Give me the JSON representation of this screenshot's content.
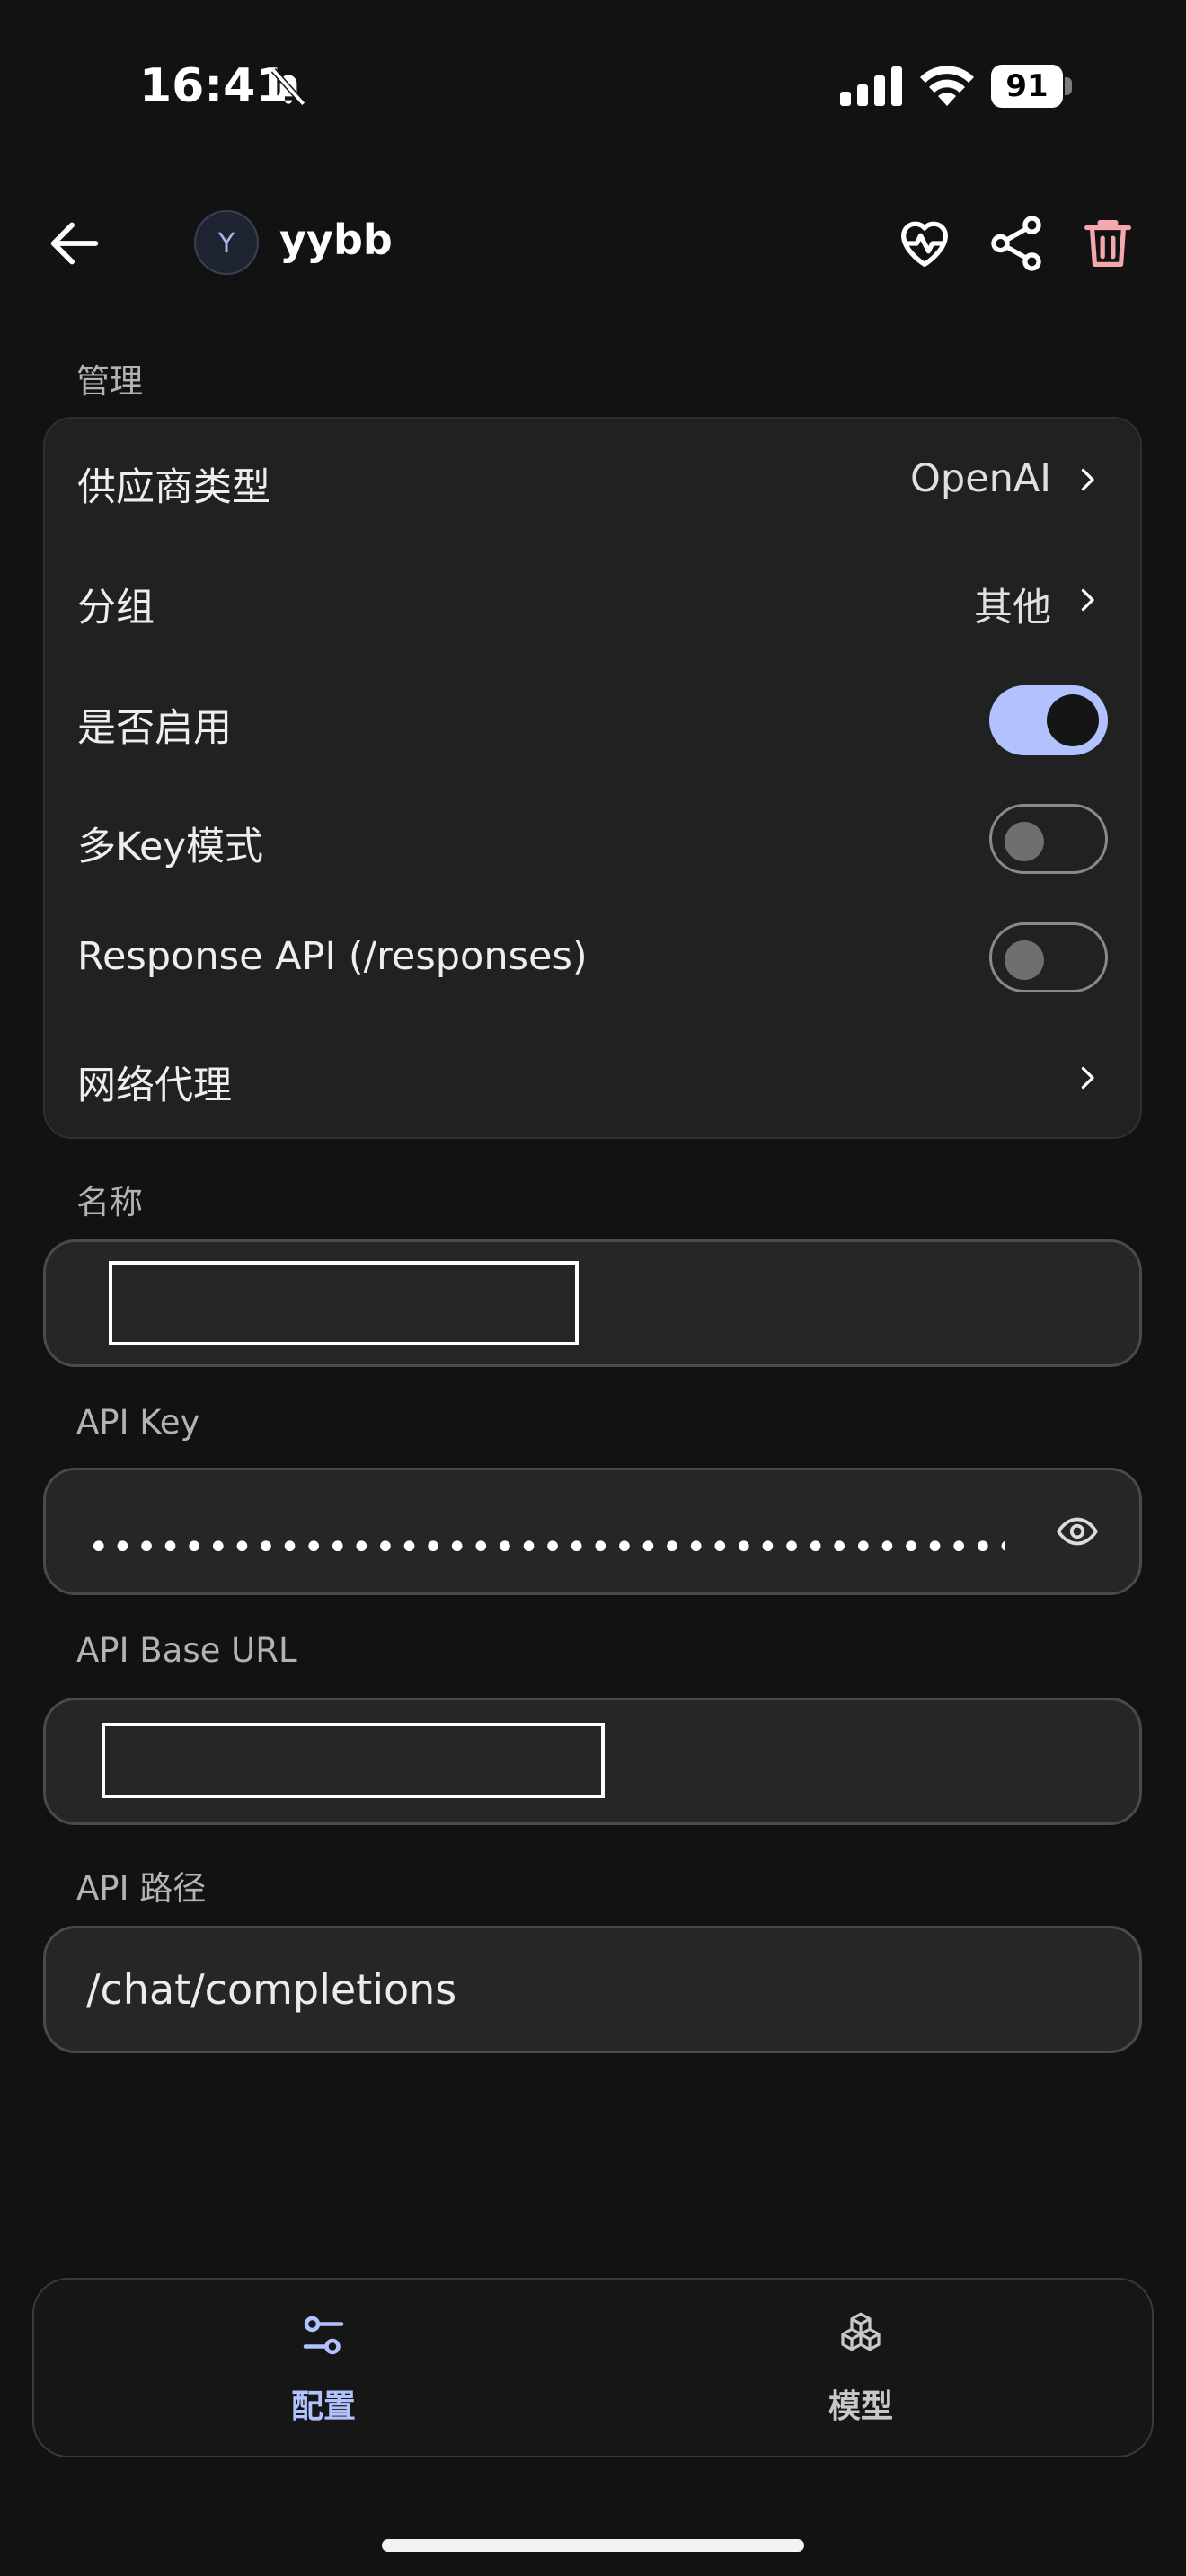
{
  "status_bar": {
    "time": "16:41",
    "battery": "91"
  },
  "header": {
    "avatar_letter": "Y",
    "title": "yybb"
  },
  "manage": {
    "section_label": "管理",
    "rows": [
      {
        "label": "供应商类型",
        "value": "OpenAI"
      },
      {
        "label": "分组",
        "value": "其他"
      },
      {
        "label": "是否启用",
        "toggle": true
      },
      {
        "label": "多Key模式",
        "toggle": false
      },
      {
        "label": "Response API (/responses)",
        "toggle": false
      },
      {
        "label": "网络代理"
      }
    ]
  },
  "fields": {
    "name_label": "名称",
    "name_value": "",
    "api_key_label": "API Key",
    "api_key_masked": "••••••••••••••••••••••••••••••••••••••••",
    "base_url_label": "API Base URL",
    "base_url_value": "",
    "path_label": "API 路径",
    "path_value": "/chat/completions"
  },
  "tabs": [
    {
      "label": "配置",
      "icon": "sliders-icon",
      "active": true
    },
    {
      "label": "模型",
      "icon": "cubes-icon",
      "active": false
    }
  ],
  "colors": {
    "background": "#121212",
    "accent": "#b1c2ff",
    "danger": "#f4a7ad"
  }
}
